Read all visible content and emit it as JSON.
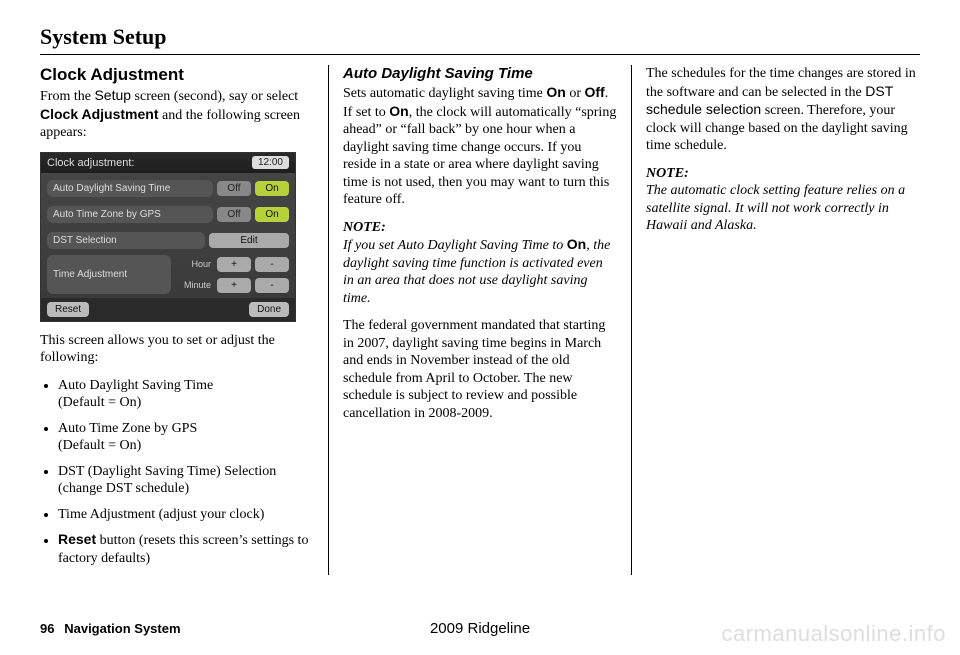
{
  "page": {
    "title": "System Setup",
    "number": "96",
    "footer_label": "Navigation System",
    "model_year": "2009  Ridgeline",
    "watermark": "carmanualsonline.info"
  },
  "col1": {
    "heading": "Clock Adjustment",
    "intro_before_setup": "From the ",
    "setup_word": "Setup",
    "intro_mid": " screen (second), say or select ",
    "clock_adj_bold": "Clock Adjustment",
    "intro_after": " and the following screen appears:",
    "after_shot": "This screen allows you to set or adjust the following:",
    "bullets": [
      {
        "main": "Auto Daylight Saving Time",
        "sub": "(Default = On)"
      },
      {
        "main": "Auto Time Zone by GPS",
        "sub": "(Default = On)"
      },
      {
        "main": "DST (Daylight Saving Time) Selection",
        "sub": "(change DST schedule)"
      },
      {
        "main": "Time Adjustment (adjust your clock)",
        "sub": ""
      }
    ],
    "reset_bold": "Reset",
    "reset_rest": " button (resets this screen’s settings to factory defaults)"
  },
  "shot": {
    "title": "Clock adjustment:",
    "clock": "12:00",
    "rows": {
      "adst": {
        "label": "Auto Daylight Saving Time",
        "off": "Off",
        "on": "On"
      },
      "atz": {
        "label": "Auto Time Zone by GPS",
        "off": "Off",
        "on": "On"
      },
      "dst": {
        "label": "DST Selection",
        "edit": "Edit"
      },
      "ta": {
        "label": "Time Adjustment",
        "hour": "Hour",
        "minute": "Minute",
        "plus": "+",
        "minus": "-"
      }
    },
    "reset": "Reset",
    "done": "Done"
  },
  "col2": {
    "heading": "Auto Daylight Saving Time",
    "p1a": "Sets automatic daylight saving time ",
    "on": "On",
    "p1b": " or ",
    "off": "Off",
    "p1c": ". If set to ",
    "p1d": ", the clock will automatically “spring ahead” or “fall back” by one hour when a daylight saving time change occurs. If you reside in a state or area where daylight saving time is not used, then you may want to turn this feature off.",
    "note_label": "NOTE:",
    "note_a": "If you set Auto Daylight Saving Time to ",
    "note_on": "On",
    "note_b": ", the daylight saving time function is activated even in an area that does not use daylight saving time.",
    "p2": "The federal government mandated that starting in 2007, daylight saving time begins in March and ends in November instead of the old schedule from April to October. The new schedule is subject to review and possible cancellation in 2008-2009."
  },
  "col3": {
    "p1a": "The schedules for the time changes are stored in the software and can be selected in the ",
    "dst_sel": "DST schedule selection",
    "p1b": " screen. Therefore, your clock will change based on the daylight saving time schedule.",
    "note_label": "NOTE:",
    "note": "The automatic clock setting feature relies on a satellite signal. It will not work correctly in Hawaii and Alaska."
  }
}
